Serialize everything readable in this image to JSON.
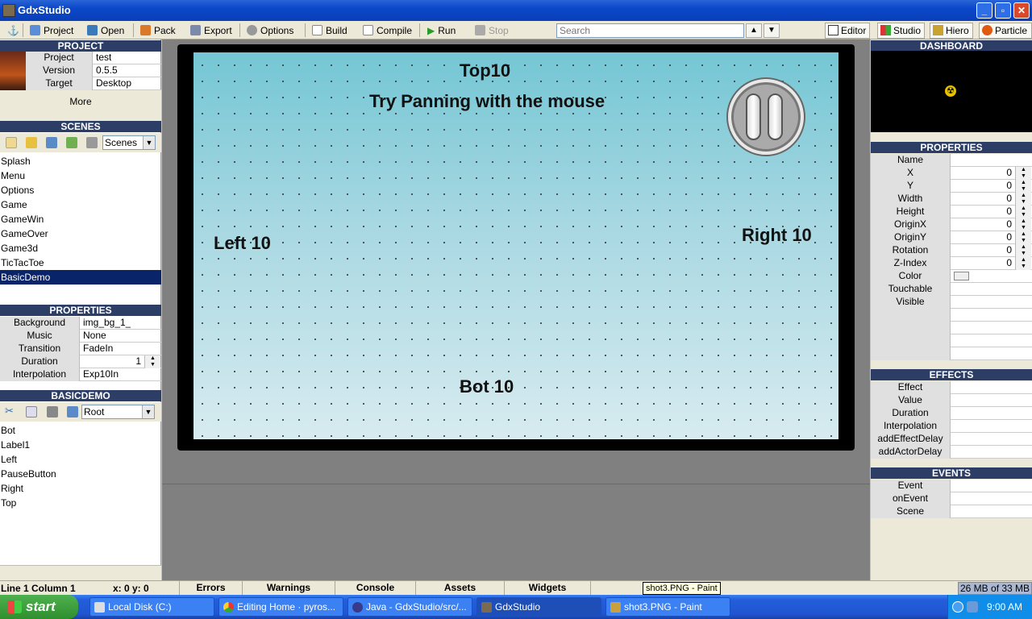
{
  "window": {
    "title": "GdxStudio"
  },
  "toolbar": {
    "items": [
      "Project",
      "Open",
      "Pack",
      "Export",
      "Options",
      "Build",
      "Compile",
      "Run",
      "Stop"
    ],
    "search_placeholder": "Search",
    "tabs": [
      "Editor",
      "Studio",
      "Hiero",
      "Particle"
    ]
  },
  "project": {
    "header": "PROJECT",
    "rows": [
      {
        "label": "Project",
        "value": "test"
      },
      {
        "label": "Version",
        "value": "0.5.5"
      },
      {
        "label": "Target",
        "value": "Desktop"
      }
    ],
    "more": "More"
  },
  "scenes": {
    "header": "SCENES",
    "combo": "Scenes",
    "items": [
      "Splash",
      "Menu",
      "Options",
      "Game",
      "GameWin",
      "GameOver",
      "Game3d",
      "TicTacToe",
      "BasicDemo"
    ],
    "selected": "BasicDemo"
  },
  "scene_properties": {
    "header": "PROPERTIES",
    "rows": [
      {
        "label": "Background",
        "value": "img_bg_1_"
      },
      {
        "label": "Music",
        "value": "None"
      },
      {
        "label": "Transition",
        "value": "FadeIn"
      },
      {
        "label": "Duration",
        "value": "1"
      },
      {
        "label": "Interpolation",
        "value": "Exp10In"
      }
    ]
  },
  "actors": {
    "header": "BASICDEMO",
    "combo": "Root",
    "items": [
      "Bot",
      "Label1",
      "Left",
      "PauseButton",
      "Right",
      "Top"
    ]
  },
  "stage": {
    "top": "Top10",
    "label1": "Try Panning with the mouse",
    "left": "Left 10",
    "right": "Right 10",
    "bot": "Bot 10"
  },
  "dashboard": {
    "header": "DASHBOARD"
  },
  "actor_properties": {
    "header": "PROPERTIES",
    "rows": [
      {
        "label": "Name",
        "value": ""
      },
      {
        "label": "X",
        "value": "0"
      },
      {
        "label": "Y",
        "value": "0"
      },
      {
        "label": "Width",
        "value": "0"
      },
      {
        "label": "Height",
        "value": "0"
      },
      {
        "label": "OriginX",
        "value": "0"
      },
      {
        "label": "OriginY",
        "value": "0"
      },
      {
        "label": "Rotation",
        "value": "0"
      },
      {
        "label": "Z-Index",
        "value": "0"
      },
      {
        "label": "Color",
        "value": ""
      },
      {
        "label": "Touchable",
        "value": ""
      },
      {
        "label": "Visible",
        "value": ""
      }
    ]
  },
  "effects": {
    "header": "EFFECTS",
    "rows": [
      "Effect",
      "Value",
      "Duration",
      "Interpolation",
      "addEffectDelay",
      "addActorDelay"
    ]
  },
  "events": {
    "header": "EVENTS",
    "rows": [
      "Event",
      "onEvent",
      "Scene"
    ]
  },
  "statusbar": {
    "position": "Line 1 Column 1",
    "coords": "x: 0 y: 0",
    "tabs": [
      "Errors",
      "Warnings",
      "Console",
      "Assets",
      "Widgets"
    ],
    "tooltip": "shot3.PNG - Paint",
    "memory": "26 MB  of  33 MB"
  },
  "taskbar": {
    "start": "start",
    "tasks": [
      "Local Disk (C:)",
      "Editing Home · pyros...",
      "Java - GdxStudio/src/...",
      "GdxStudio",
      "shot3.PNG - Paint"
    ],
    "clock": "9:00 AM"
  }
}
